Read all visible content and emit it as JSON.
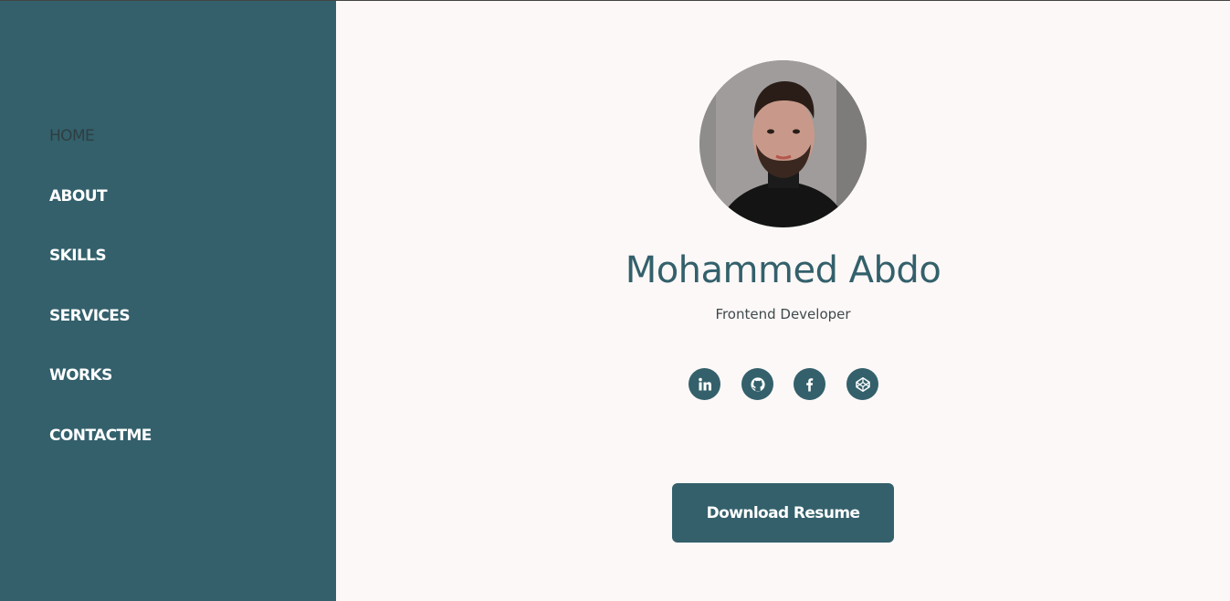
{
  "nav": {
    "items": [
      {
        "label": "HOME",
        "active": true
      },
      {
        "label": "ABOUT"
      },
      {
        "label": "SKILLS"
      },
      {
        "label": "SERVICES"
      },
      {
        "label": "WORKS"
      },
      {
        "label": "CONTACTME"
      }
    ]
  },
  "profile": {
    "name": "Mohammed Abdo",
    "role": "Frontend Developer"
  },
  "social": {
    "icons": [
      "linkedin-icon",
      "github-icon",
      "facebook-icon",
      "codepen-icon"
    ]
  },
  "cta": {
    "label": "Download Resume"
  },
  "colors": {
    "accent": "#33606b",
    "background": "#fcf8f7",
    "nav_active": "#2f3e42"
  }
}
